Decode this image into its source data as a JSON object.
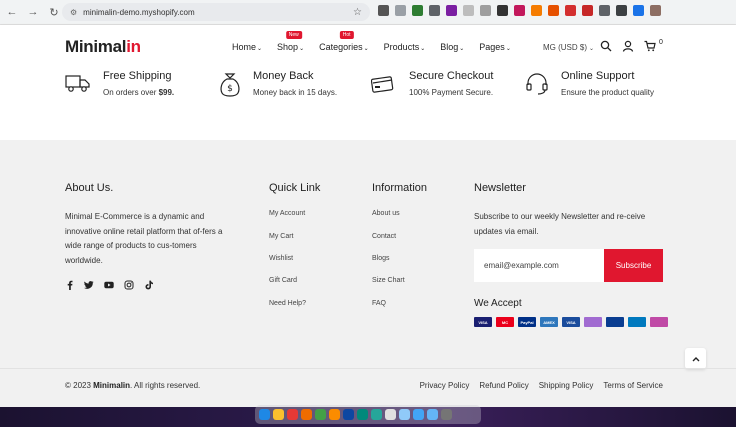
{
  "browser": {
    "url": "minimalin-demo.myshopify.com",
    "extension_colors": [
      "#555555",
      "#9aa0a6",
      "#2e7d32",
      "#5f6368",
      "#7b1fa2",
      "#bdbdbd",
      "#9e9e9e",
      "#333333",
      "#c2185b",
      "#f57c00",
      "#e65100",
      "#d32f2f",
      "#c62828",
      "#5f6368",
      "#3c4043",
      "#1a73e8",
      "#8d6e63"
    ]
  },
  "header": {
    "logo_dark": "Minimal",
    "logo_red": "in",
    "menu": [
      {
        "label": "Home",
        "badge": ""
      },
      {
        "label": "Shop",
        "badge": "New"
      },
      {
        "label": "Categories",
        "badge": "Hot"
      },
      {
        "label": "Products",
        "badge": ""
      },
      {
        "label": "Blog",
        "badge": ""
      },
      {
        "label": "Pages",
        "badge": ""
      }
    ],
    "currency": "MG (USD $)",
    "cart_count": "0"
  },
  "features": [
    {
      "title": "Free Shipping",
      "subtitle": "On orders over ",
      "subtitle_bold": "$99.",
      "icon": "truck-icon"
    },
    {
      "title": "Money Back",
      "subtitle": "Money back in 15 days.",
      "subtitle_bold": "",
      "icon": "money-bag-icon"
    },
    {
      "title": "Secure Checkout",
      "subtitle": "100% Payment Secure.",
      "subtitle_bold": "",
      "icon": "credit-card-icon"
    },
    {
      "title": "Online Support",
      "subtitle": "Ensure the product quality",
      "subtitle_bold": "",
      "icon": "headset-icon"
    }
  ],
  "footer": {
    "about": {
      "title": "About Us.",
      "text": "Minimal E-Commerce is a dynamic and innovative online retail platform that of-fers a wide range of products to cus-tomers worldwide."
    },
    "social_icons": [
      "facebook-icon",
      "twitter-icon",
      "youtube-icon",
      "instagram-icon",
      "tiktok-icon"
    ],
    "quick_link": {
      "title": "Quick Link",
      "items": [
        "My Account",
        "My Cart",
        "Wishlist",
        "Gift Card",
        "Need Help?"
      ]
    },
    "information": {
      "title": "Information",
      "items": [
        "About us",
        "Contact",
        "Blogs",
        "Size Chart",
        "FAQ"
      ]
    },
    "newsletter": {
      "title": "Newsletter",
      "text": "Subscribe to our weekly Newsletter and re-ceive updates via email.",
      "email_placeholder": "email@example.com",
      "subscribe_label": "Subscribe",
      "we_accept": "We Accept",
      "payment_methods": [
        {
          "name": "VISA",
          "color": "#1a1f71"
        },
        {
          "name": "MC",
          "color": "#eb001b"
        },
        {
          "name": "PayPal",
          "color": "#003087"
        },
        {
          "name": "AMEX",
          "color": "#2e77bc"
        },
        {
          "name": "VISA",
          "color": "#1a4c9c"
        },
        {
          "name": "",
          "color": "#a16bd1"
        },
        {
          "name": "",
          "color": "#0a3d91"
        },
        {
          "name": "",
          "color": "#0079be"
        },
        {
          "name": "",
          "color": "#c04aa6"
        }
      ]
    },
    "copyright_prefix": "© 2023 ",
    "copyright_brand": "Minimalin",
    "copyright_suffix": ". All rights reserved.",
    "policies": [
      "Privacy Policy",
      "Refund Policy",
      "Shipping Policy",
      "Terms of Service"
    ]
  },
  "dock": {
    "app_colors": [
      "#1e88e5",
      "#fbc02d",
      "#e53935",
      "#ef6c00",
      "#43a047",
      "#fb8c00",
      "#0d47a1",
      "#00897b",
      "#26a69a",
      "#e0e0e0",
      "#90caf9",
      "#42a5f5",
      "#64b5f6",
      "#757575"
    ]
  }
}
